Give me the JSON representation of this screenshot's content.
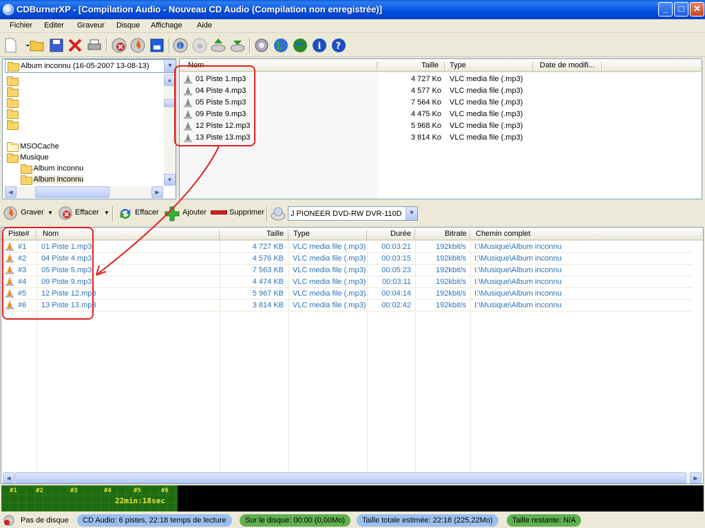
{
  "window": {
    "title": "CDBurnerXP - [Compilation Audio - Nouveau CD Audio (Compilation non enregistrée)]"
  },
  "menu": [
    "Fichier",
    "Editer",
    "Graveur",
    "Disque",
    "Affichage",
    "Aide"
  ],
  "tree": {
    "combo": "Album inconnu (16-05-2007 13-08-13)",
    "items": [
      "",
      "",
      "",
      "",
      "",
      "MSOCache",
      "Musique",
      "Album inconnu",
      "Album inconnu"
    ]
  },
  "files": {
    "headers": {
      "name": "Nom",
      "size": "Taille",
      "type": "Type",
      "date": "Date de modifi..."
    },
    "rows": [
      {
        "name": "01 Piste 1.mp3",
        "size": "4 727 Ko",
        "type": "VLC media file (.mp3)"
      },
      {
        "name": "04 Piste 4.mp3",
        "size": "4 577 Ko",
        "type": "VLC media file (.mp3)"
      },
      {
        "name": "05 Piste 5.mp3",
        "size": "7 564 Ko",
        "type": "VLC media file (.mp3)"
      },
      {
        "name": "09 Piste 9.mp3",
        "size": "4 475 Ko",
        "type": "VLC media file (.mp3)"
      },
      {
        "name": "12 Piste 12.mp3",
        "size": "5 968 Ko",
        "type": "VLC media file (.mp3)"
      },
      {
        "name": "13 Piste 13.mp3",
        "size": "3 814 Ko",
        "type": "VLC media file (.mp3)"
      }
    ]
  },
  "toolbar2": {
    "burn": "Graver",
    "erase": "Effacer",
    "clear": "Effacer",
    "add": "Ajouter",
    "remove": "Supprimer",
    "drive": "J PIONEER DVD-RW  DVR-110D"
  },
  "compilation": {
    "headers": {
      "track": "Piste#",
      "name": "Nom",
      "size": "Taille",
      "type": "Type",
      "duration": "Durée",
      "bitrate": "Bitrate",
      "path": "Chemin complet"
    },
    "rows": [
      {
        "track": "#1",
        "name": "01 Piste 1.mp3",
        "size": "4 727 KB",
        "type": "VLC media file (.mp3)",
        "duration": "00:03:21",
        "bitrate": "192kbit/s",
        "path": "I:\\Musique\\Album inconnu"
      },
      {
        "track": "#2",
        "name": "04 Piste 4.mp3",
        "size": "4 576 KB",
        "type": "VLC media file (.mp3)",
        "duration": "00:03:15",
        "bitrate": "192kbit/s",
        "path": "I:\\Musique\\Album inconnu"
      },
      {
        "track": "#3",
        "name": "05 Piste 5.mp3",
        "size": "7 563 KB",
        "type": "VLC media file (.mp3)",
        "duration": "00:05:23",
        "bitrate": "192kbit/s",
        "path": "I:\\Musique\\Album inconnu"
      },
      {
        "track": "#4",
        "name": "09 Piste 9.mp3",
        "size": "4 474 KB",
        "type": "VLC media file (.mp3)",
        "duration": "00:03:11",
        "bitrate": "192kbit/s",
        "path": "I:\\Musique\\Album inconnu"
      },
      {
        "track": "#5",
        "name": "12 Piste 12.mp3",
        "size": "5 967 KB",
        "type": "VLC media file (.mp3)",
        "duration": "00:04:14",
        "bitrate": "192kbit/s",
        "path": "I:\\Musique\\Album inconnu"
      },
      {
        "track": "#6",
        "name": "13 Piste 13.mp3",
        "size": "3 814 KB",
        "type": "VLC media file (.mp3)",
        "duration": "00:02:42",
        "bitrate": "192kbit/s",
        "path": "I:\\Musique\\Album inconnu"
      }
    ]
  },
  "timeline": {
    "labels": [
      "#1",
      "#2",
      "#3",
      "#4",
      "#5",
      "#6"
    ],
    "total": "22min:18sec"
  },
  "status": {
    "disc": "Pas de disque",
    "compilation": "CD Audio: 6 pistes, 22:18 temps de lecture",
    "on_disc": "Sur le disque: 00:00 (0,00Mo)",
    "estimated": "Taille totale estimée: 22:18 (225,22Mo)",
    "remaining": "Taille restante: N/A"
  },
  "colors": {
    "title_blue": "#0050e0",
    "track_text": "#2a73b8",
    "annotation_red": "#e02020",
    "timeline_green": "#1f6b12"
  }
}
